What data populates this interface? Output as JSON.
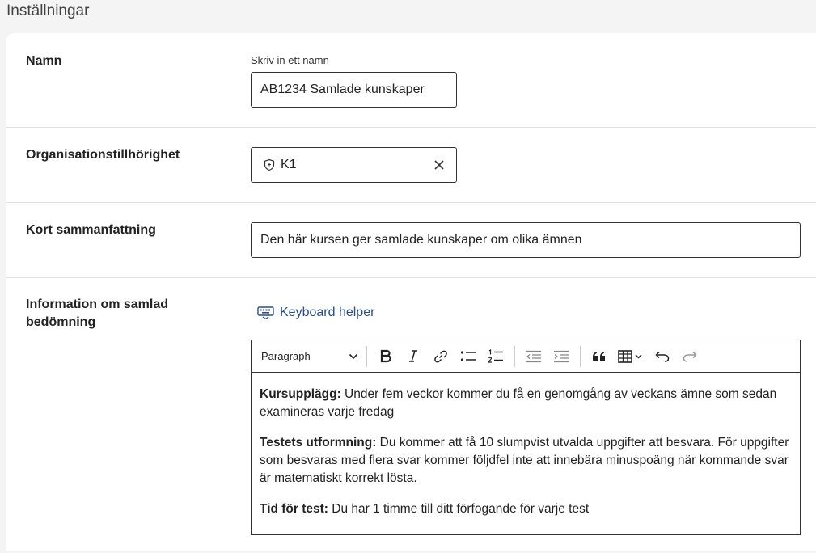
{
  "page": {
    "title": "Inställningar"
  },
  "name_row": {
    "label": "Namn",
    "hint": "Skriv in ett namn",
    "value": "AB1234 Samlade kunskaper"
  },
  "org_row": {
    "label": "Organisationstillhörighet",
    "value": "K1",
    "icon": "shield-icon"
  },
  "summary_row": {
    "label": "Kort sammanfattning",
    "value": "Den här kursen ger samlade kunskaper om olika ämnen"
  },
  "info_row": {
    "label": "Information om samlad bedömning",
    "keyboard_helper": "Keyboard helper",
    "toolbar": {
      "paragraph_label": "Paragraph",
      "buttons": [
        "bold-icon",
        "italic-icon",
        "link-icon",
        "bullet-list-icon",
        "numbered-list-icon",
        "outdent-icon",
        "indent-icon",
        "blockquote-icon",
        "table-icon",
        "undo-icon",
        "redo-icon"
      ]
    },
    "content": [
      {
        "heading": "Kursupplägg:",
        "text": " Under fem veckor kommer du få en genomgång av veckans ämne som sedan examineras varje fredag"
      },
      {
        "heading": "Testets utformning:",
        "text": " Du kommer att få 10 slumpvist utvalda uppgifter att besvara. För uppgifter som besvaras med flera svar kommer följdfel inte att innebära minuspoäng när kommande svar är matematiskt korrekt lösta."
      },
      {
        "heading": "Tid för test:",
        "text": " Du har 1 timme till ditt förfogande för varje test"
      }
    ]
  },
  "colors": {
    "link": "#2d4e7f",
    "border": "#333333",
    "divider": "#e2e2e2"
  }
}
